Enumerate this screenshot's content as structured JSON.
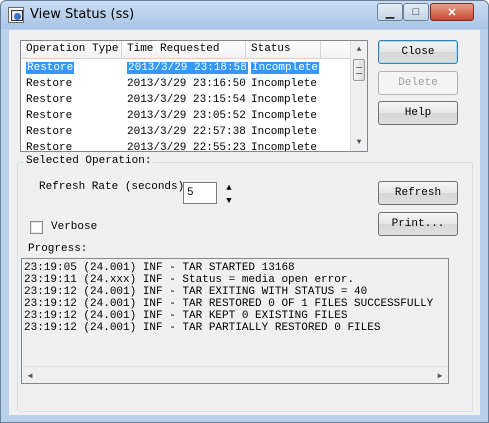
{
  "window": {
    "title": "View Status (ss)",
    "controls": {
      "minimize": "▁",
      "maximize": "□",
      "close": "✕"
    }
  },
  "list": {
    "columns": [
      "Operation Type",
      "Time Requested",
      "Status",
      ""
    ],
    "rows": [
      {
        "type": "Restore",
        "time": "2013/3/29 23:18:58",
        "status": "Incomplete",
        "selected": true
      },
      {
        "type": "Restore",
        "time": "2013/3/29 23:16:50",
        "status": "Incomplete",
        "selected": false
      },
      {
        "type": "Restore",
        "time": "2013/3/29 23:15:54",
        "status": "Incomplete",
        "selected": false
      },
      {
        "type": "Restore",
        "time": "2013/3/29 23:05:52",
        "status": "Incomplete",
        "selected": false
      },
      {
        "type": "Restore",
        "time": "2013/3/29 22:57:38",
        "status": "Incomplete",
        "selected": false
      },
      {
        "type": "Restore",
        "time": "2013/3/29 22:55:23",
        "status": "Incomplete",
        "selected": false
      }
    ]
  },
  "buttons": {
    "close": "Close",
    "delete": "Delete",
    "help": "Help",
    "refresh": "Refresh",
    "print": "Print..."
  },
  "selected_operation": {
    "group_label": "Selected Operation:",
    "refresh_rate_label": "Refresh Rate (seconds):",
    "refresh_rate_value": "5",
    "verbose_label": "Verbose",
    "verbose_checked": false,
    "progress_label": "Progress:",
    "progress_lines": [
      "23:19:05 (24.001) INF - TAR STARTED 13168",
      "23:19:11 (24.xxx) INF - Status = media open error.",
      "23:19:12 (24.001) INF - TAR EXITING WITH STATUS = 40",
      "23:19:12 (24.001) INF - TAR RESTORED 0 OF 1 FILES SUCCESSFULLY",
      "23:19:12 (24.001) INF - TAR KEPT 0 EXISTING FILES",
      "23:19:12 (24.001) INF - TAR PARTIALLY RESTORED 0 FILES"
    ]
  }
}
